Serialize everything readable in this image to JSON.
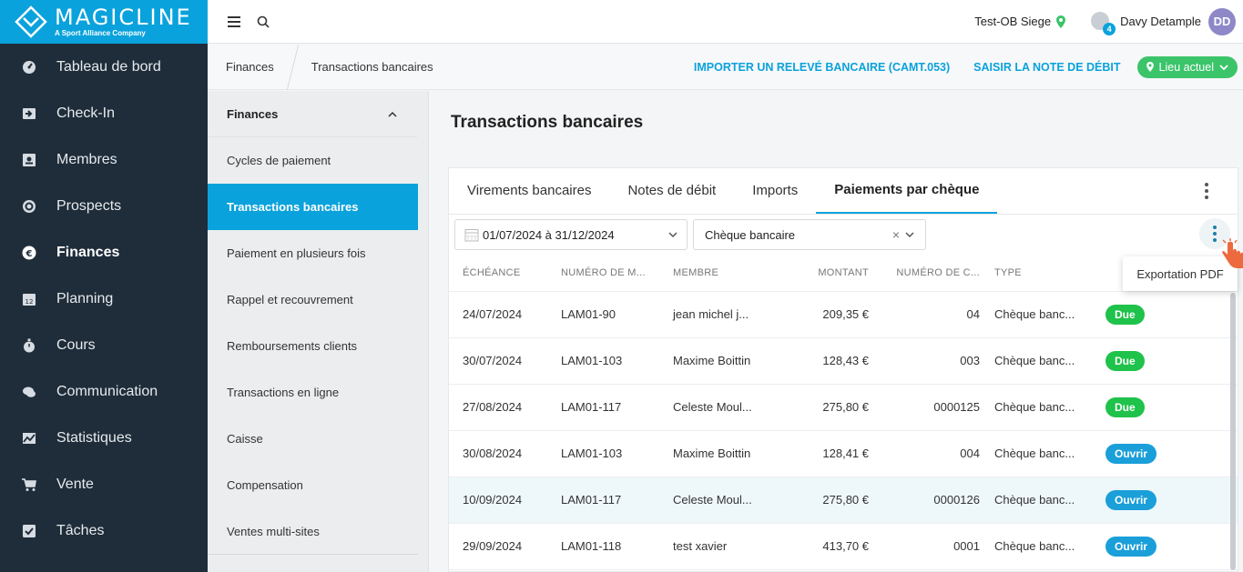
{
  "app": {
    "logo_title": "MAGICLINE",
    "logo_subtitle": "A Sport Alliance Company",
    "brand_color": "#0aa2dc"
  },
  "sidebar": {
    "items": [
      {
        "label": "Tableau de bord",
        "icon": "dashboard-icon"
      },
      {
        "label": "Check-In",
        "icon": "check-in-icon"
      },
      {
        "label": "Membres",
        "icon": "members-icon"
      },
      {
        "label": "Prospects",
        "icon": "prospects-icon"
      },
      {
        "label": "Finances",
        "icon": "euro-icon",
        "active": true
      },
      {
        "label": "Planning",
        "icon": "calendar-icon"
      },
      {
        "label": "Cours",
        "icon": "stopwatch-icon"
      },
      {
        "label": "Communication",
        "icon": "chat-icon"
      },
      {
        "label": "Statistiques",
        "icon": "chart-icon"
      },
      {
        "label": "Vente",
        "icon": "cart-icon"
      },
      {
        "label": "Tâches",
        "icon": "checkbox-icon"
      }
    ]
  },
  "header": {
    "location": "Test-OB Siege",
    "notification_count": "4",
    "user_name": "Davy Detample",
    "avatar_initials": "DD"
  },
  "breadcrumb": {
    "items": [
      "Finances",
      "Transactions bancaires"
    ],
    "import_link": "IMPORTER UN RELEVÉ BANCAIRE (CAMT.053)",
    "debit_link": "SAISIR LA NOTE DE DÉBIT",
    "location_button": "Lieu actuel"
  },
  "submenu": {
    "heading": "Finances",
    "items": [
      "Cycles de paiement",
      "Transactions bancaires",
      "Paiement en plusieurs fois",
      "Rappel et recouvrement",
      "Remboursements clients",
      "Transactions en ligne",
      "Caisse",
      "Compensation",
      "Ventes multi-sites"
    ],
    "active_index": 1
  },
  "main": {
    "title": "Transactions bancaires",
    "tabs": [
      "Virements bancaires",
      "Notes de débit",
      "Imports",
      "Paiements par chèque"
    ],
    "active_tab": 3,
    "filters": {
      "date_range": "01/07/2024 à 31/12/2024",
      "payment_type": "Chèque bancaire"
    },
    "table": {
      "headers": [
        "ÉCHÉANCE",
        "NUMÉRO DE M...",
        "MEMBRE",
        "MONTANT",
        "NUMÉRO DE C...",
        "TYPE",
        ""
      ],
      "rows": [
        {
          "date": "24/07/2024",
          "number": "LAM01-90",
          "member": "jean michel j...",
          "amount": "209,35 €",
          "cheque": "04",
          "type": "Chèque banc...",
          "status": "Due",
          "status_kind": "due"
        },
        {
          "date": "30/07/2024",
          "number": "LAM01-103",
          "member": "Maxime Boittin",
          "amount": "128,43 €",
          "cheque": "003",
          "type": "Chèque banc...",
          "status": "Due",
          "status_kind": "due"
        },
        {
          "date": "27/08/2024",
          "number": "LAM01-117",
          "member": "Celeste Moul...",
          "amount": "275,80 €",
          "cheque": "0000125",
          "type": "Chèque banc...",
          "status": "Due",
          "status_kind": "due"
        },
        {
          "date": "30/08/2024",
          "number": "LAM01-103",
          "member": "Maxime Boittin",
          "amount": "128,41 €",
          "cheque": "004",
          "type": "Chèque banc...",
          "status": "Ouvrir",
          "status_kind": "open"
        },
        {
          "date": "10/09/2024",
          "number": "LAM01-117",
          "member": "Celeste Moul...",
          "amount": "275,80 €",
          "cheque": "0000126",
          "type": "Chèque banc...",
          "status": "Ouvrir",
          "status_kind": "open",
          "highlighted": true
        },
        {
          "date": "29/09/2024",
          "number": "LAM01-118",
          "member": "test xavier",
          "amount": "413,70 €",
          "cheque": "0001",
          "type": "Chèque banc...",
          "status": "Ouvrir",
          "status_kind": "open"
        }
      ]
    },
    "context_menu": {
      "items": [
        "Exportation PDF"
      ]
    }
  },
  "colors": {
    "due": "#1fc24a",
    "open": "#1a9fd9",
    "sidebar_bg": "#1f2d3a",
    "location_green": "#3bc46a"
  }
}
